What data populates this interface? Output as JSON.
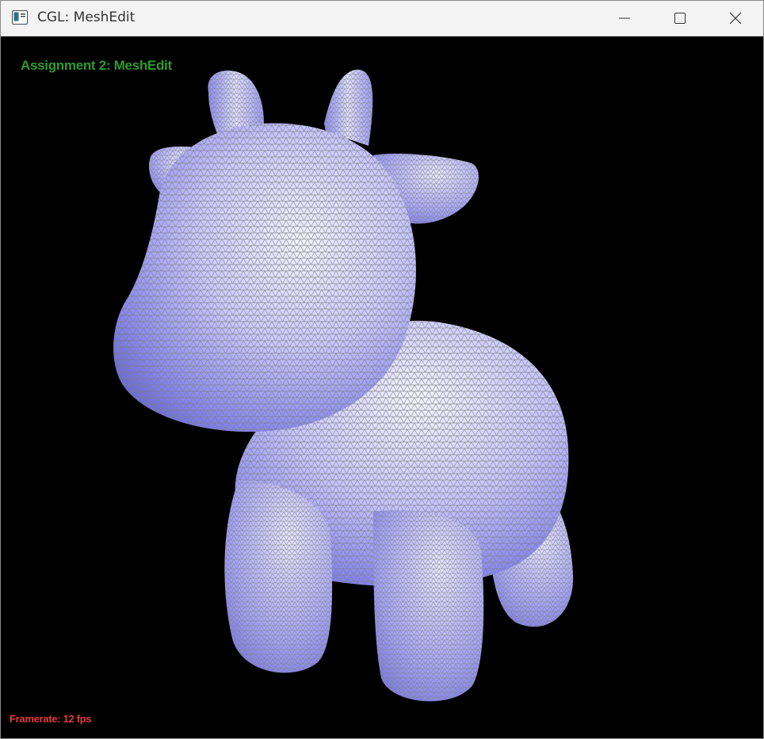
{
  "window": {
    "title": "CGL: MeshEdit"
  },
  "titlebar_icons": {
    "app": "app-window-icon",
    "minimize": "minimize-icon",
    "maximize": "maximize-icon",
    "close": "close-icon"
  },
  "viewport": {
    "background": "#000000",
    "overlay_title": "Assignment 2: MeshEdit",
    "overlay_title_color": "#2e9a2e",
    "framerate": "Framerate: 12 fps",
    "framerate_color": "#e23c3c",
    "mesh_color": "#a6a6ff",
    "wire_color": "#7f7f7f"
  }
}
